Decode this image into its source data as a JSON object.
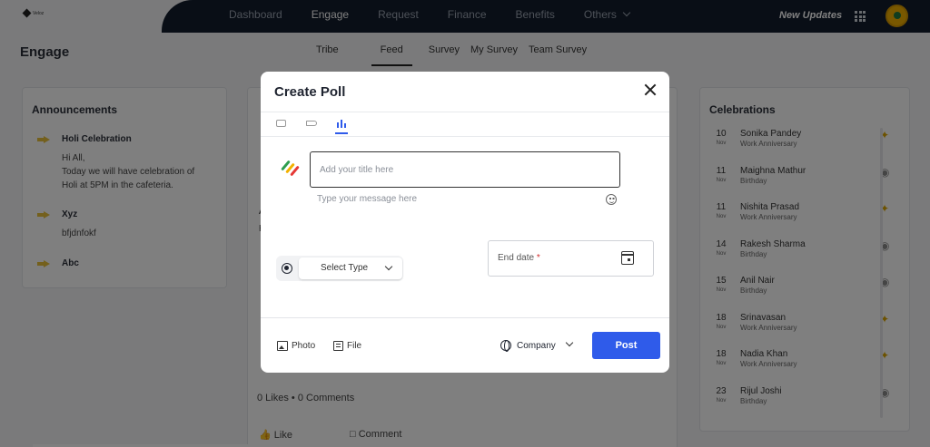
{
  "app": {
    "logo_text": "Veloz"
  },
  "nav": {
    "items": [
      "Dashboard",
      "Engage",
      "Request",
      "Finance",
      "Benefits",
      "Others"
    ],
    "active": "Engage",
    "new_updates": "New Updates"
  },
  "page": {
    "title": "Engage"
  },
  "subtabs": {
    "items": [
      "Tribe",
      "Feed",
      "Survey",
      "My Survey",
      "Team Survey"
    ],
    "active": "Feed"
  },
  "announcements": {
    "title": "Announcements",
    "items": [
      {
        "heading": "Holi Celebration",
        "body": "Hi All,\nToday we will have celebration of\nHoli at 5PM in the cafeteria."
      },
      {
        "heading": "Xyz",
        "body": "bfjdnfokf"
      },
      {
        "heading": "Abc",
        "body": ""
      }
    ]
  },
  "feed": {
    "post_initial": "A",
    "post_line_initial": "H",
    "likes": "0 Likes",
    "comments": "0 Comments",
    "like_label": "Like",
    "comment_label": "Comment"
  },
  "celebrations": {
    "title": "Celebrations",
    "items": [
      {
        "day": "10",
        "month": "Nov",
        "name": "Sonika Pandey",
        "type": "Work Anniversary",
        "icon": "party-popper-icon"
      },
      {
        "day": "11",
        "month": "Nov",
        "name": "Maighna Mathur",
        "type": "Birthday",
        "icon": "cake-icon"
      },
      {
        "day": "11",
        "month": "Nov",
        "name": "Nishita Prasad",
        "type": "Work Anniversary",
        "icon": "party-popper-icon"
      },
      {
        "day": "14",
        "month": "Nov",
        "name": "Rakesh Sharma",
        "type": "Birthday",
        "icon": "cake-icon"
      },
      {
        "day": "15",
        "month": "Nov",
        "name": "Anil Nair",
        "type": "Birthday",
        "icon": "cake-icon"
      },
      {
        "day": "18",
        "month": "Nov",
        "name": "Srinavasan",
        "type": "Work Anniversary",
        "icon": "party-popper-icon"
      },
      {
        "day": "18",
        "month": "Nov",
        "name": "Nadia Khan",
        "type": "Work Anniversary",
        "icon": "party-popper-icon"
      },
      {
        "day": "23",
        "month": "Nov",
        "name": "Rijul Joshi",
        "type": "Birthday",
        "icon": "cake-icon"
      }
    ]
  },
  "modal": {
    "title": "Create Poll",
    "tabs": [
      {
        "name": "text-post-icon",
        "active": false
      },
      {
        "name": "announcement-icon",
        "active": false
      },
      {
        "name": "poll-icon",
        "active": true
      }
    ],
    "title_placeholder": "Add your title here",
    "message_placeholder": "Type your message here",
    "select_type_label": "Select Type",
    "end_date_label": "End date",
    "end_date_required_mark": "*",
    "photo_label": "Photo",
    "file_label": "File",
    "audience_label": "Company",
    "post_label": "Post",
    "colors": {
      "accent": "#2f5bea",
      "nav_bg": "#121c2d"
    }
  }
}
